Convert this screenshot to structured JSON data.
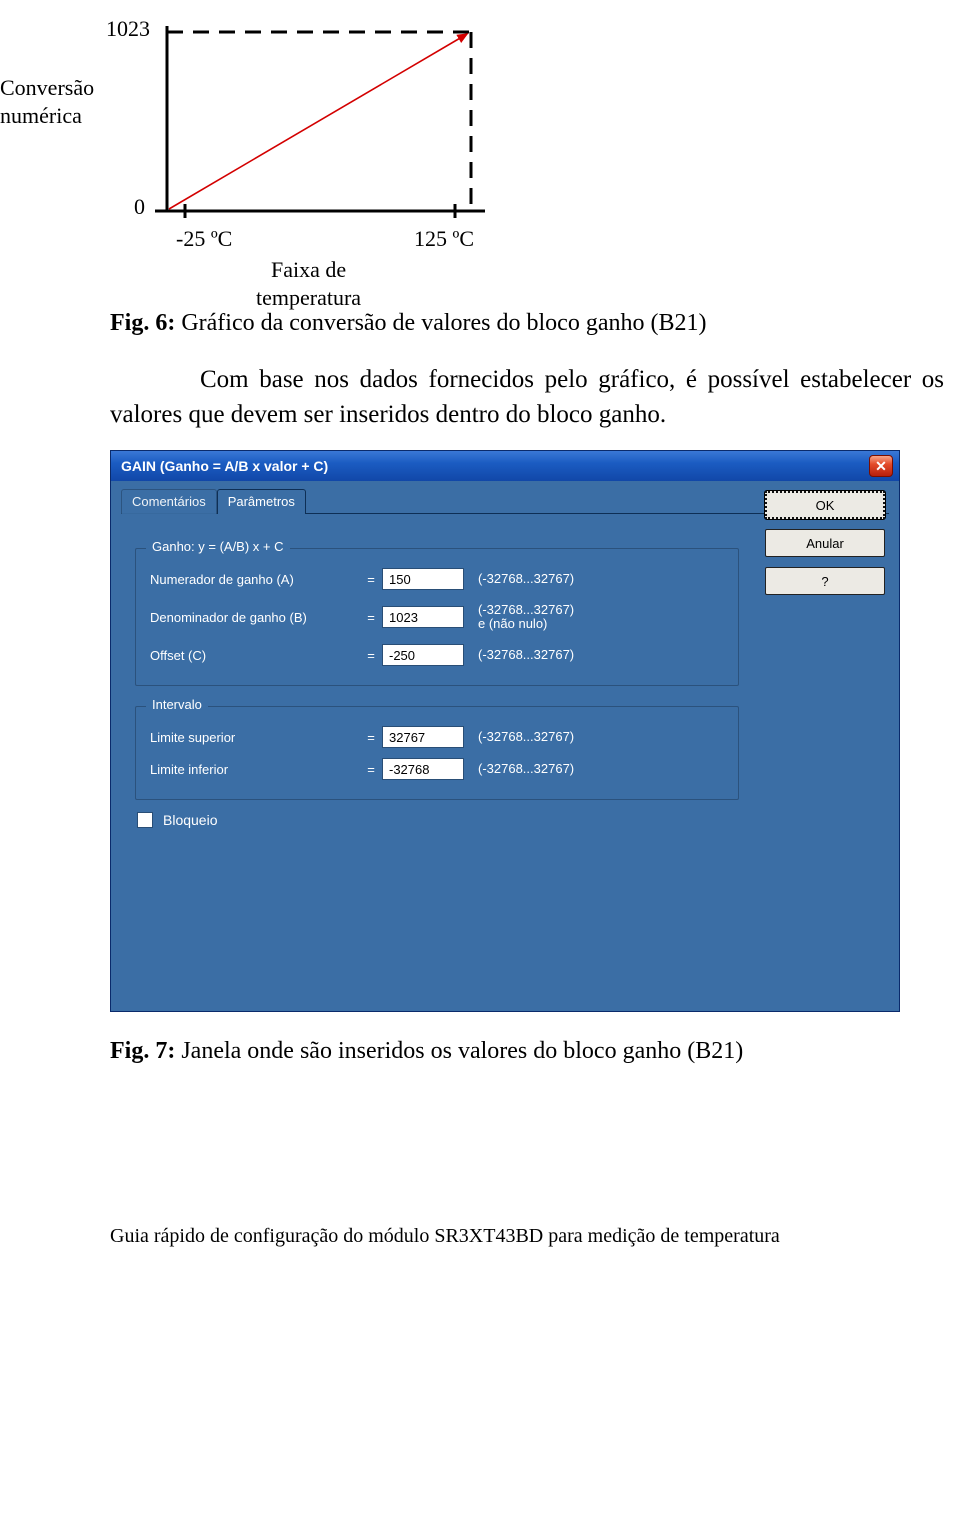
{
  "chart_data": {
    "type": "line",
    "categories": [
      "-25 °C",
      "125 °C"
    ],
    "x": [
      -25,
      125
    ],
    "values": [
      0,
      1023
    ],
    "title": "",
    "xlabel": "Faixa de temperatura",
    "ylabel": "Conversão numérica",
    "xlim": [
      -25,
      125
    ],
    "ylim": [
      0,
      1023
    ]
  },
  "labels": {
    "y_max": "1023",
    "y_min": "0",
    "x_min": "-25 ºC",
    "x_max": "125 ºC",
    "y_axis_line1": "Conversão",
    "y_axis_line2": "numérica",
    "x_axis_line1": "Faixa de",
    "x_axis_line2": "temperatura"
  },
  "fig6": {
    "prefix": "Fig. 6:",
    "text": " Gráfico da conversão de valores do bloco ganho (B21)"
  },
  "paragraph": "Com base nos dados fornecidos pelo gráfico, é possível estabelecer os valores que devem ser inseridos dentro do bloco ganho.",
  "dialog": {
    "title": "GAIN (Ganho = A/B x valor + C)",
    "tabs": {
      "comentarios": "Comentários",
      "parametros": "Parâmetros"
    },
    "buttons": {
      "ok": "OK",
      "anular": "Anular",
      "help": "?"
    },
    "group_ganho": {
      "legend": "Ganho:  y = (A/B) x + C",
      "rows": [
        {
          "label": "Numerador de ganho (A)",
          "eq": "=",
          "value": "150",
          "hint": "(-32768...32767)"
        },
        {
          "label": "Denominador de ganho (B)",
          "eq": "=",
          "value": "1023",
          "hint": "(-32768...32767)\ne (não nulo)"
        },
        {
          "label": "Offset (C)",
          "eq": "=",
          "value": "-250",
          "hint": "(-32768...32767)"
        }
      ]
    },
    "group_intervalo": {
      "legend": "Intervalo",
      "rows": [
        {
          "label": "Limite superior",
          "eq": "=",
          "value": "32767",
          "hint": "(-32768...32767)"
        },
        {
          "label": "Limite inferior",
          "eq": "=",
          "value": "-32768",
          "hint": "(-32768...32767)"
        }
      ]
    },
    "bloqueio": "Bloqueio"
  },
  "fig7": {
    "prefix": "Fig. 7:",
    "text": " Janela onde são inseridos os valores do bloco ganho (B21)"
  },
  "footer": "Guia rápido de configuração do módulo SR3XT43BD para medição de temperatura"
}
